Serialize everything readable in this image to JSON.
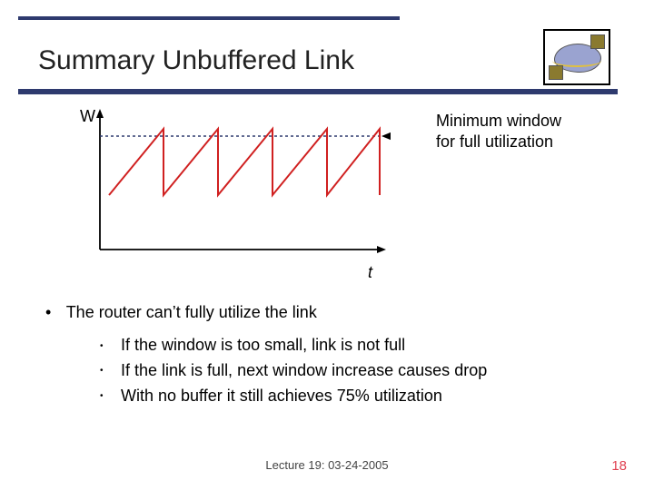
{
  "title": "Summary Unbuffered Link",
  "chart_data": {
    "type": "line",
    "title": "",
    "xlabel": "t",
    "ylabel": "W",
    "xlim": [
      0,
      10
    ],
    "ylim": [
      0,
      1.1
    ],
    "threshold_y": 1.0,
    "annotation": "Minimum window\nfor full utilization",
    "series": [
      {
        "name": "W",
        "color": "#d02020",
        "x": [
          0,
          2,
          2,
          4,
          4,
          6,
          6,
          8,
          8,
          10,
          10
        ],
        "y": [
          0.5,
          1.05,
          0.5,
          1.05,
          0.5,
          1.05,
          0.5,
          1.05,
          0.5,
          1.05,
          0.5
        ]
      }
    ]
  },
  "bullets": {
    "main": "The router can’t fully utilize the link",
    "subs": [
      "If the window is too small, link is not full",
      "If the link is full, next window increase causes drop",
      "With no buffer it still achieves 75% utilization"
    ]
  },
  "footer": {
    "lecture": "Lecture 19: 03-24-2005",
    "page": "18"
  }
}
